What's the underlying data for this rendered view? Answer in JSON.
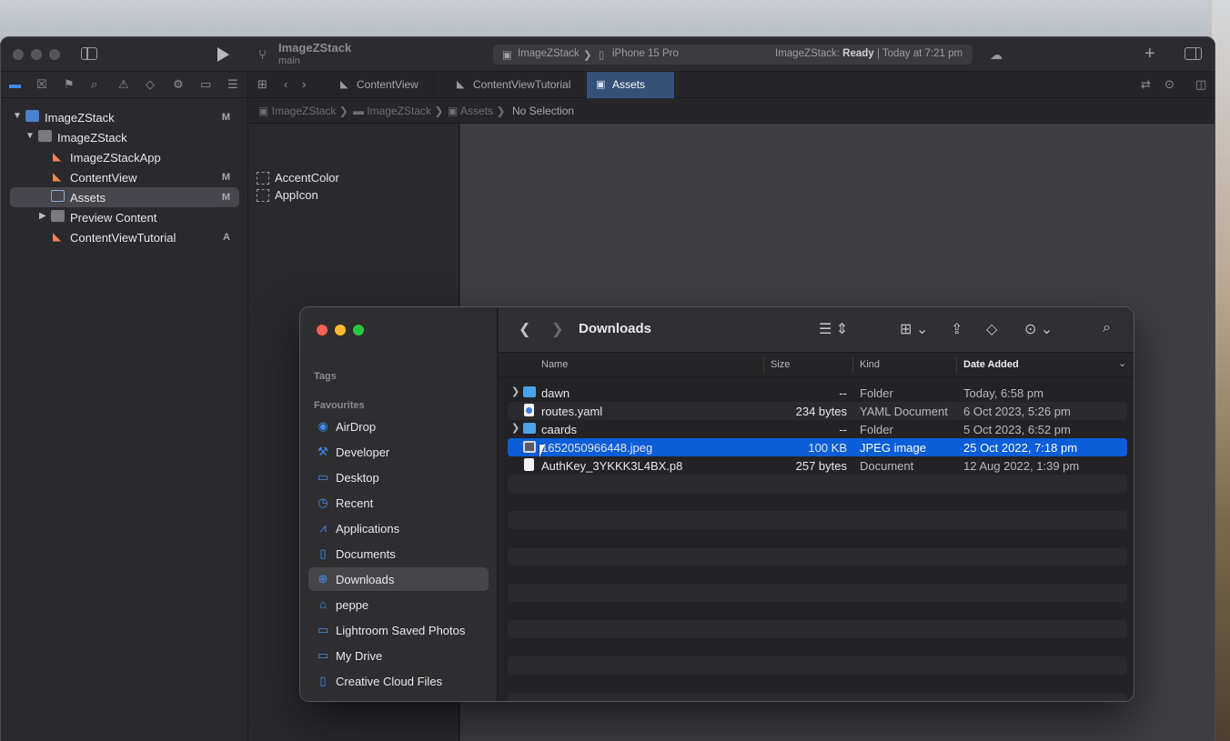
{
  "xcode": {
    "project_title": "ImageZStack",
    "branch": "main",
    "scheme": "ImageZStack",
    "device": "iPhone 15 Pro",
    "status_prefix": "ImageZStack:",
    "status_state": "Ready",
    "status_time": "| Today at 7:21 pm",
    "navigator": [
      {
        "label": "ImageZStack",
        "badge": "M"
      },
      {
        "label": "ImageZStack",
        "badge": ""
      },
      {
        "label": "ImageZStackApp",
        "badge": ""
      },
      {
        "label": "ContentView",
        "badge": "M"
      },
      {
        "label": "Assets",
        "badge": "M"
      },
      {
        "label": "Preview Content",
        "badge": ""
      },
      {
        "label": "ContentViewTutorial",
        "badge": "A"
      }
    ],
    "tabs": [
      "ContentView",
      "ContentViewTutorial",
      "Assets"
    ],
    "breadcrumb": [
      "ImageZStack",
      "ImageZStack",
      "Assets",
      "No Selection"
    ],
    "assets": [
      "AccentColor",
      "AppIcon"
    ]
  },
  "finder": {
    "title": "Downloads",
    "sidebar_sections": {
      "tags": "Tags",
      "favourites": "Favourites"
    },
    "sidebar_items": [
      {
        "label": "AirDrop",
        "icon": "airdrop-icon"
      },
      {
        "label": "Developer",
        "icon": "hammer-icon"
      },
      {
        "label": "Desktop",
        "icon": "desktop-icon"
      },
      {
        "label": "Recent",
        "icon": "clock-icon"
      },
      {
        "label": "Applications",
        "icon": "applications-icon"
      },
      {
        "label": "Documents",
        "icon": "document-icon"
      },
      {
        "label": "Downloads",
        "icon": "download-icon"
      },
      {
        "label": "peppe",
        "icon": "home-icon"
      },
      {
        "label": "Lightroom Saved Photos",
        "icon": "folder-icon"
      },
      {
        "label": "My Drive",
        "icon": "folder-icon"
      },
      {
        "label": "Creative Cloud Files",
        "icon": "file-icon"
      }
    ],
    "columns": {
      "name": "Name",
      "size": "Size",
      "kind": "Kind",
      "date": "Date Added"
    },
    "files": [
      {
        "name": "dawn",
        "size": "--",
        "kind": "Folder",
        "date": "Today, 6:58 pm"
      },
      {
        "name": "routes.yaml",
        "size": "234 bytes",
        "kind": "YAML Document",
        "date": "6 Oct 2023, 5:26 pm"
      },
      {
        "name": "caards",
        "size": "--",
        "kind": "Folder",
        "date": "5 Oct 2023, 6:52 pm"
      },
      {
        "name": "1652050966448.jpeg",
        "size": "100 KB",
        "kind": "JPEG image",
        "date": "25 Oct 2022, 7:18 pm"
      },
      {
        "name": "AuthKey_3YKKK3L4BX.p8",
        "size": "257 bytes",
        "kind": "Document",
        "date": "12 Aug 2022, 1:39 pm"
      }
    ],
    "colors": {
      "accent": "#0b5ed8",
      "folder": "#4ba3ee"
    }
  }
}
